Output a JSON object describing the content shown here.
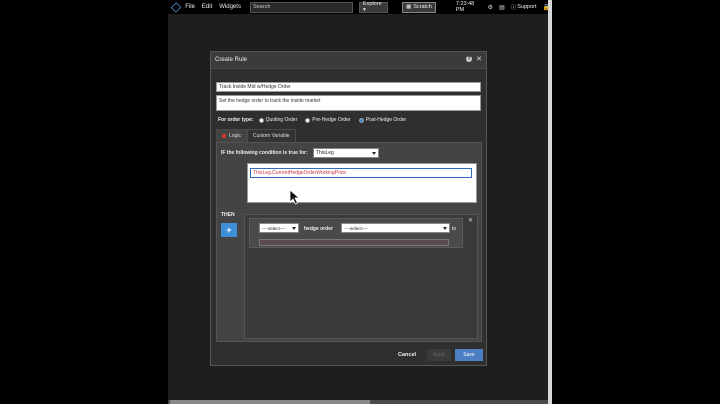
{
  "topbar": {
    "menu": [
      "File",
      "Edit",
      "Widgets"
    ],
    "search_value": "Search",
    "explore_label": "Explore ▾",
    "scratch_label": "Scratch",
    "time": "7:23:48 PM",
    "support_label": "Support"
  },
  "dialog": {
    "title": "Create Rule",
    "help_glyph": "?",
    "close_glyph": "✕",
    "name_value": "Track Inside Mid w/Hedge Order",
    "description_value": "Set the hedge order to track the inside market",
    "order_type": {
      "label": "For order type:",
      "options": [
        "Quoting Order",
        "Pre-Hedge Order",
        "Post-Hedge Order"
      ],
      "selected": "Post-Hedge Order"
    },
    "tabs": [
      "Logic",
      "Custom Variable"
    ],
    "if_label": "IF the following condition is true for:",
    "leg_value": "ThisLeg",
    "condition_value": "ThisLeg.CurrentHedgeOrderWorkingPrice",
    "then_label": "THEN",
    "plus_glyph": "+",
    "action": {
      "select1_value": "----select----",
      "hedge_label": "hedge order",
      "select2_value": "----select----",
      "to_label": "to",
      "remove_glyph": "✕"
    },
    "footer": {
      "cancel": "Cancel",
      "apply": "Apply",
      "save": "Save"
    }
  }
}
